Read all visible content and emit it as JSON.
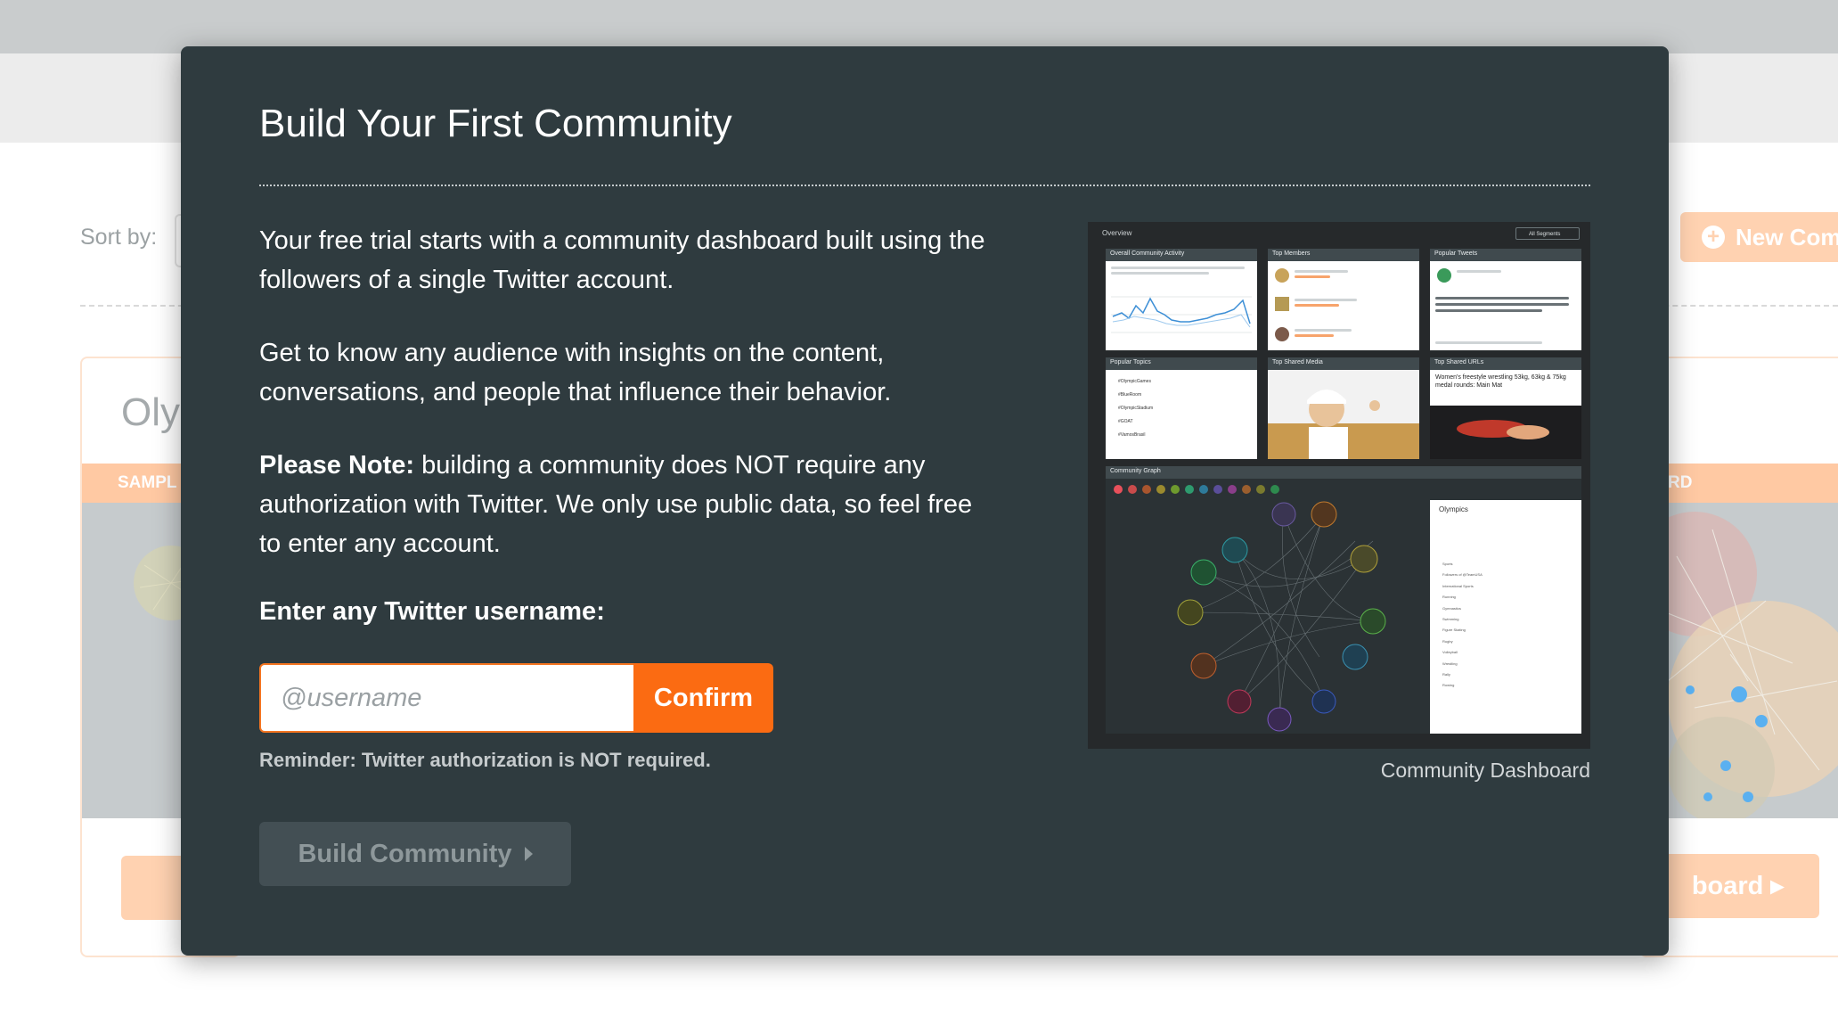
{
  "background": {
    "sort_label": "Sort by:",
    "new_button_label": "New Com",
    "left_card": {
      "title": "Oly",
      "band": "SAMPL"
    },
    "right_card": {
      "band": "RD",
      "button_label": "board"
    }
  },
  "modal": {
    "title": "Build Your First Community",
    "paragraph_1": "Your free trial starts with a community dashboard built using the followers of a single Twitter account.",
    "paragraph_2": "Get to know any audience with insights on the content, conversations, and people that influence their behavior.",
    "note_lead": "Please Note:",
    "note_text": " building a community does NOT require any authorization with Twitter. We only use public data, so feel free to enter any account.",
    "enter_label": "Enter any Twitter username:",
    "username_placeholder": "@username",
    "username_value": "",
    "confirm_label": "Confirm",
    "reminder": "Reminder: Twitter authorization is NOT required.",
    "build_label": "Build Community",
    "preview_caption": "Community Dashboard"
  },
  "preview": {
    "overview_label": "Overview",
    "segments_select": "All Segments",
    "cards": [
      "Overall Community Activity",
      "Top Members",
      "Popular Tweets",
      "Popular Topics",
      "Top Shared Media",
      "Top Shared URLs"
    ],
    "graph_title": "Community Graph",
    "graph_panel_title": "Olympics",
    "url_snippet": "Women's freestyle wrestling 53kg, 63kg & 75kg medal rounds: Main Mat",
    "topics": [
      "#OlympicGames",
      "#BlueRoom",
      "#OlympicStadium",
      "#GOAT",
      "#VamosBrasil"
    ],
    "segments": [
      "Sports",
      "Followers of @TeamUSA",
      "International Sports",
      "Running",
      "Gymnastics",
      "Swimming",
      "Figure Skating",
      "Rugby",
      "Volleyball",
      "Wrestling",
      "Rally",
      "Rowing"
    ]
  },
  "colors": {
    "modal_bg": "#2f3b3f",
    "accent": "#fb6b12",
    "muted_button": "#434f54"
  }
}
